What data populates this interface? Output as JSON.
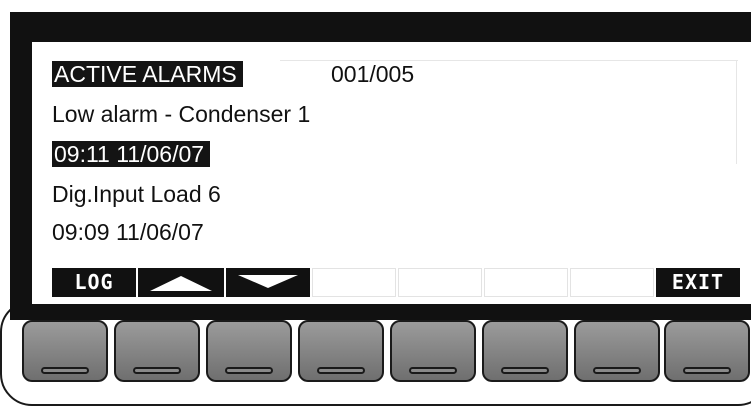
{
  "screen": {
    "title": "ACTIVE ALARMS",
    "counter": "001/005",
    "alarms": [
      {
        "description": "Low alarm - Condenser 1",
        "timestamp": "09:11 11/06/07"
      },
      {
        "description": "Dig.Input Load 6",
        "timestamp": "09:09 11/06/07"
      }
    ]
  },
  "softkeys": {
    "log_label": "LOG",
    "up_icon": "triangle-up-icon",
    "down_icon": "triangle-down-icon",
    "exit_label": "EXIT"
  },
  "colors": {
    "bezel": "#111111",
    "highlight": "#141414",
    "key": "#7f7f7f"
  }
}
